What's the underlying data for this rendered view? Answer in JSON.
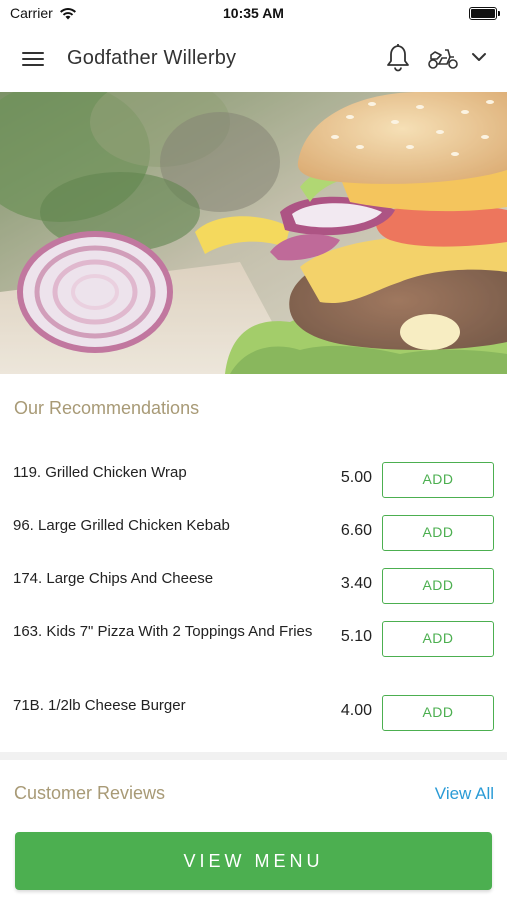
{
  "status_bar": {
    "carrier": "Carrier",
    "time": "10:35 AM",
    "icons": [
      "wifi-icon",
      "battery-icon"
    ]
  },
  "header": {
    "title": "Godfather Willerby",
    "icons": [
      "menu-icon",
      "bell-icon",
      "scooter-icon",
      "chevron-down-icon"
    ]
  },
  "hero": {
    "image": "burger-banner-image"
  },
  "recommendations": {
    "title": "Our Recommendations",
    "items": [
      {
        "name": "119. Grilled Chicken Wrap",
        "price": "5.00",
        "action": "ADD"
      },
      {
        "name": "96. Large Grilled Chicken Kebab",
        "price": "6.60",
        "action": "ADD"
      },
      {
        "name": "174. Large Chips And Cheese",
        "price": "3.40",
        "action": "ADD"
      },
      {
        "name": "163. Kids 7\" Pizza With 2 Toppings And Fries",
        "price": "5.10",
        "action": "ADD"
      },
      {
        "name": "71B. 1/2lb Cheese Burger",
        "price": "4.00",
        "action": "ADD"
      }
    ]
  },
  "reviews": {
    "title": "Customer Reviews",
    "view_all": "View All"
  },
  "footer": {
    "view_menu": "VIEW MENU"
  },
  "colors": {
    "accent_green": "#4caf50",
    "section_title": "#a89a76",
    "link_blue": "#2a9bd6"
  }
}
